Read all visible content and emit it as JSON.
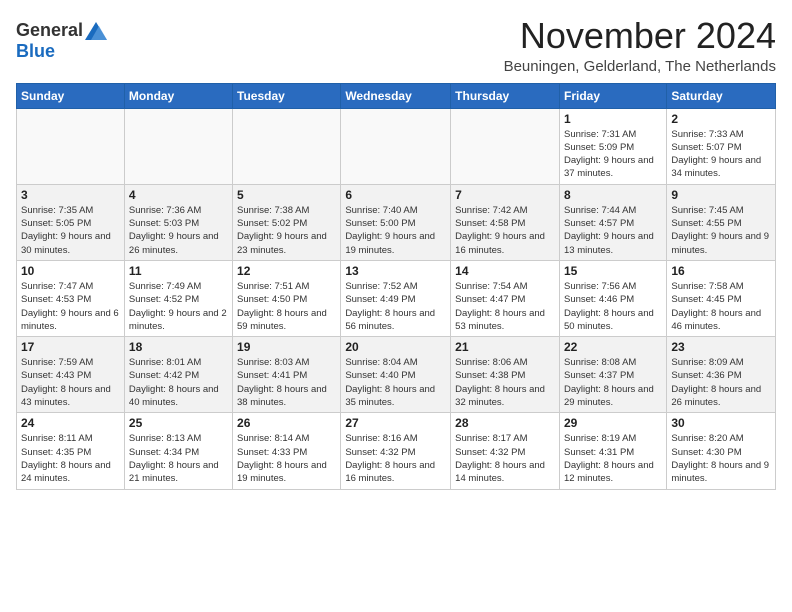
{
  "logo": {
    "general": "General",
    "blue": "Blue"
  },
  "header": {
    "title": "November 2024",
    "location": "Beuningen, Gelderland, The Netherlands"
  },
  "weekdays": [
    "Sunday",
    "Monday",
    "Tuesday",
    "Wednesday",
    "Thursday",
    "Friday",
    "Saturday"
  ],
  "weeks": [
    [
      {
        "day": "",
        "detail": ""
      },
      {
        "day": "",
        "detail": ""
      },
      {
        "day": "",
        "detail": ""
      },
      {
        "day": "",
        "detail": ""
      },
      {
        "day": "",
        "detail": ""
      },
      {
        "day": "1",
        "detail": "Sunrise: 7:31 AM\nSunset: 5:09 PM\nDaylight: 9 hours and 37 minutes."
      },
      {
        "day": "2",
        "detail": "Sunrise: 7:33 AM\nSunset: 5:07 PM\nDaylight: 9 hours and 34 minutes."
      }
    ],
    [
      {
        "day": "3",
        "detail": "Sunrise: 7:35 AM\nSunset: 5:05 PM\nDaylight: 9 hours and 30 minutes."
      },
      {
        "day": "4",
        "detail": "Sunrise: 7:36 AM\nSunset: 5:03 PM\nDaylight: 9 hours and 26 minutes."
      },
      {
        "day": "5",
        "detail": "Sunrise: 7:38 AM\nSunset: 5:02 PM\nDaylight: 9 hours and 23 minutes."
      },
      {
        "day": "6",
        "detail": "Sunrise: 7:40 AM\nSunset: 5:00 PM\nDaylight: 9 hours and 19 minutes."
      },
      {
        "day": "7",
        "detail": "Sunrise: 7:42 AM\nSunset: 4:58 PM\nDaylight: 9 hours and 16 minutes."
      },
      {
        "day": "8",
        "detail": "Sunrise: 7:44 AM\nSunset: 4:57 PM\nDaylight: 9 hours and 13 minutes."
      },
      {
        "day": "9",
        "detail": "Sunrise: 7:45 AM\nSunset: 4:55 PM\nDaylight: 9 hours and 9 minutes."
      }
    ],
    [
      {
        "day": "10",
        "detail": "Sunrise: 7:47 AM\nSunset: 4:53 PM\nDaylight: 9 hours and 6 minutes."
      },
      {
        "day": "11",
        "detail": "Sunrise: 7:49 AM\nSunset: 4:52 PM\nDaylight: 9 hours and 2 minutes."
      },
      {
        "day": "12",
        "detail": "Sunrise: 7:51 AM\nSunset: 4:50 PM\nDaylight: 8 hours and 59 minutes."
      },
      {
        "day": "13",
        "detail": "Sunrise: 7:52 AM\nSunset: 4:49 PM\nDaylight: 8 hours and 56 minutes."
      },
      {
        "day": "14",
        "detail": "Sunrise: 7:54 AM\nSunset: 4:47 PM\nDaylight: 8 hours and 53 minutes."
      },
      {
        "day": "15",
        "detail": "Sunrise: 7:56 AM\nSunset: 4:46 PM\nDaylight: 8 hours and 50 minutes."
      },
      {
        "day": "16",
        "detail": "Sunrise: 7:58 AM\nSunset: 4:45 PM\nDaylight: 8 hours and 46 minutes."
      }
    ],
    [
      {
        "day": "17",
        "detail": "Sunrise: 7:59 AM\nSunset: 4:43 PM\nDaylight: 8 hours and 43 minutes."
      },
      {
        "day": "18",
        "detail": "Sunrise: 8:01 AM\nSunset: 4:42 PM\nDaylight: 8 hours and 40 minutes."
      },
      {
        "day": "19",
        "detail": "Sunrise: 8:03 AM\nSunset: 4:41 PM\nDaylight: 8 hours and 38 minutes."
      },
      {
        "day": "20",
        "detail": "Sunrise: 8:04 AM\nSunset: 4:40 PM\nDaylight: 8 hours and 35 minutes."
      },
      {
        "day": "21",
        "detail": "Sunrise: 8:06 AM\nSunset: 4:38 PM\nDaylight: 8 hours and 32 minutes."
      },
      {
        "day": "22",
        "detail": "Sunrise: 8:08 AM\nSunset: 4:37 PM\nDaylight: 8 hours and 29 minutes."
      },
      {
        "day": "23",
        "detail": "Sunrise: 8:09 AM\nSunset: 4:36 PM\nDaylight: 8 hours and 26 minutes."
      }
    ],
    [
      {
        "day": "24",
        "detail": "Sunrise: 8:11 AM\nSunset: 4:35 PM\nDaylight: 8 hours and 24 minutes."
      },
      {
        "day": "25",
        "detail": "Sunrise: 8:13 AM\nSunset: 4:34 PM\nDaylight: 8 hours and 21 minutes."
      },
      {
        "day": "26",
        "detail": "Sunrise: 8:14 AM\nSunset: 4:33 PM\nDaylight: 8 hours and 19 minutes."
      },
      {
        "day": "27",
        "detail": "Sunrise: 8:16 AM\nSunset: 4:32 PM\nDaylight: 8 hours and 16 minutes."
      },
      {
        "day": "28",
        "detail": "Sunrise: 8:17 AM\nSunset: 4:32 PM\nDaylight: 8 hours and 14 minutes."
      },
      {
        "day": "29",
        "detail": "Sunrise: 8:19 AM\nSunset: 4:31 PM\nDaylight: 8 hours and 12 minutes."
      },
      {
        "day": "30",
        "detail": "Sunrise: 8:20 AM\nSunset: 4:30 PM\nDaylight: 8 hours and 9 minutes."
      }
    ]
  ]
}
